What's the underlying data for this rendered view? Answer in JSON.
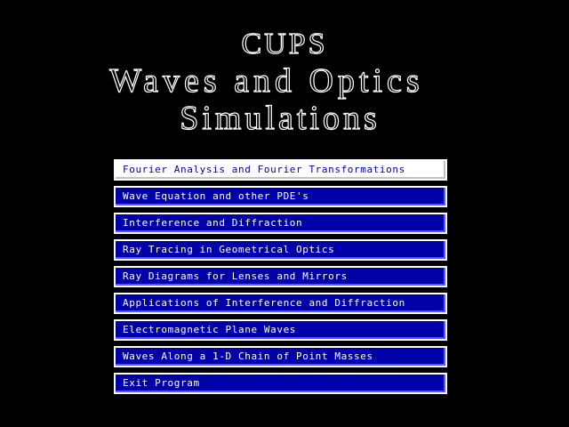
{
  "title": {
    "line1": "CUPS",
    "line2": "Waves and Optics",
    "line3": "Simulations"
  },
  "colors": {
    "background": "#000000",
    "menu_item_bg": "#0000a8",
    "menu_item_text": "#ffffff",
    "selected_bg": "#ffffff",
    "selected_text": "#0000a8"
  },
  "menu": {
    "selected_index": 0,
    "items": [
      {
        "label": "Fourier Analysis and Fourier Transformations"
      },
      {
        "label": "Wave Equation and other PDE's"
      },
      {
        "label": "Interference and Diffraction"
      },
      {
        "label": "Ray Tracing in Geometrical Optics"
      },
      {
        "label": "Ray Diagrams for Lenses and Mirrors"
      },
      {
        "label": "Applications of Interference and Diffraction"
      },
      {
        "label": "Electromagnetic Plane Waves"
      },
      {
        "label": "Waves Along a 1-D Chain of Point Masses"
      },
      {
        "label": "Exit Program"
      }
    ]
  }
}
